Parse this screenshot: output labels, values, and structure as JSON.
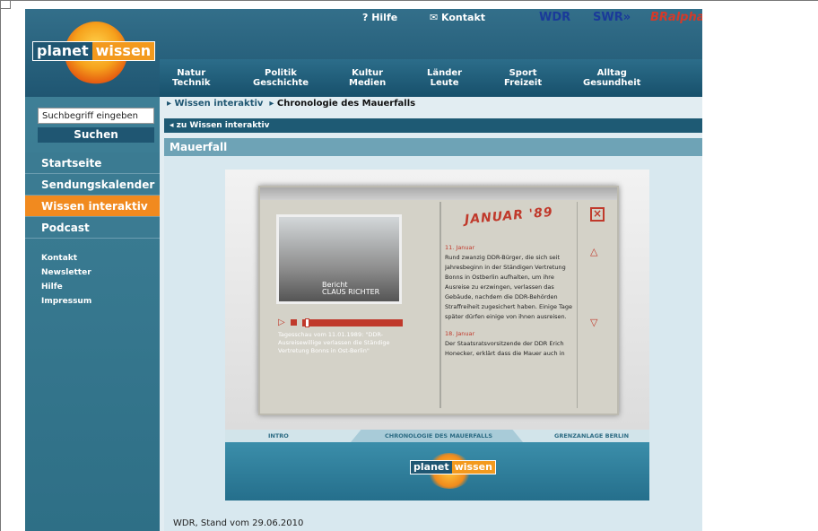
{
  "header": {
    "help": "? Hilfe",
    "contact": "✉ Kontakt",
    "senders": [
      "WDR",
      "SWR»",
      "BRalpha"
    ],
    "logo": {
      "part1": "planet",
      "part2": "wissen"
    },
    "nav": [
      {
        "l1": "Natur",
        "l2": "Technik"
      },
      {
        "l1": "Politik",
        "l2": "Geschichte"
      },
      {
        "l1": "Kultur",
        "l2": "Medien"
      },
      {
        "l1": "Länder",
        "l2": "Leute"
      },
      {
        "l1": "Sport",
        "l2": "Freizeit"
      },
      {
        "l1": "Alltag",
        "l2": "Gesundheit"
      }
    ]
  },
  "sidebar": {
    "search_placeholder": "Suchbegriff eingeben",
    "search_button": "Suchen",
    "items": [
      "Startseite",
      "Sendungskalender",
      "Wissen interaktiv",
      "Podcast"
    ],
    "sub": [
      "Kontakt",
      "Newsletter",
      "Hilfe",
      "Impressum"
    ]
  },
  "breadcrumb": {
    "item1": "Wissen interaktiv",
    "item2": "Chronologie des Mauerfalls"
  },
  "back": "zu Wissen interaktiv",
  "title": "Mauerfall",
  "flash": {
    "month": "JANUAR '89",
    "report_label": "Bericht",
    "reporter": "CLAUS RICHTER",
    "caption": "Tagesschau vom 11.01.1989: \"DDR-Ausreisewillige verlassen die Ständige Vertretung Bonns in Ost-Berlin\"",
    "entries": [
      {
        "date": "11. Januar",
        "text": "Rund zwanzig DDR-Bürger, die sich seit Jahresbeginn in der Ständigen Vertretung Bonns in Ostberlin aufhalten, um ihre Ausreise zu erzwingen, verlassen das Gebäude, nachdem die DDR-Behörden Straffreiheit zugesichert haben. Einige Tage später dürfen einige von ihnen ausreisen."
      },
      {
        "date": "18. Januar",
        "text": "Der Staatsratsvorsitzende der DDR Erich Honecker, erklärt dass die Mauer auch in"
      }
    ],
    "tabs": [
      "INTRO",
      "CHRONOLOGIE DES MAUERFALLS",
      "GRENZANLAGE BERLIN"
    ],
    "footer_logo": {
      "part1": "planet",
      "part2": "wissen"
    }
  },
  "stand": "WDR, Stand vom 29.06.2010"
}
